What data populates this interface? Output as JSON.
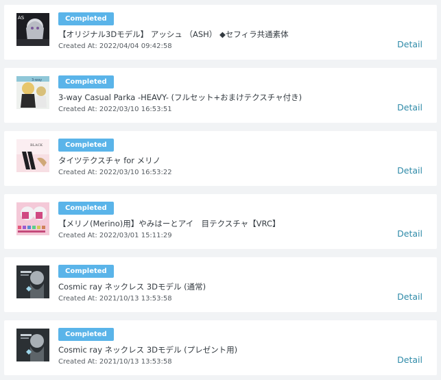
{
  "orders": [
    {
      "status": "Completed",
      "title": "【オリジナル3Dモデル】 アッシュ （ASH） ◆セフィラ共通素体",
      "created": "Created At: 2022/04/04 09:42:58",
      "detail_label": "Detail",
      "thumbnail_icon": "ash-3d-model-thumbnail"
    },
    {
      "status": "Completed",
      "title": "3-way Casual Parka -HEAVY- (フルセット+おまけテクスチャ付き)",
      "created": "Created At: 2022/03/10 16:53:51",
      "detail_label": "Detail",
      "thumbnail_icon": "parka-thumbnail"
    },
    {
      "status": "Completed",
      "title": "タイツテクスチャ for メリノ",
      "created": "Created At: 2022/03/10 16:53:22",
      "detail_label": "Detail",
      "thumbnail_icon": "tights-texture-thumbnail"
    },
    {
      "status": "Completed",
      "title": "【メリノ(Merino)用】やみはーとアイ　目テクスチャ【VRC】",
      "created": "Created At: 2022/03/01 15:11:29",
      "detail_label": "Detail",
      "thumbnail_icon": "eye-texture-thumbnail"
    },
    {
      "status": "Completed",
      "title": "Cosmic ray ネックレス 3Dモデル (通常)",
      "created": "Created At: 2021/10/13 13:53:58",
      "detail_label": "Detail",
      "thumbnail_icon": "necklace-thumbnail"
    },
    {
      "status": "Completed",
      "title": "Cosmic ray ネックレス 3Dモデル (プレゼント用)",
      "created": "Created At: 2021/10/13 13:53:58",
      "detail_label": "Detail",
      "thumbnail_icon": "necklace-gift-thumbnail"
    }
  ],
  "colors": {
    "badge": "#5ab4e9",
    "link": "#2e8aa8",
    "page_bg": "#f1f3f5",
    "card_bg": "#ffffff"
  }
}
